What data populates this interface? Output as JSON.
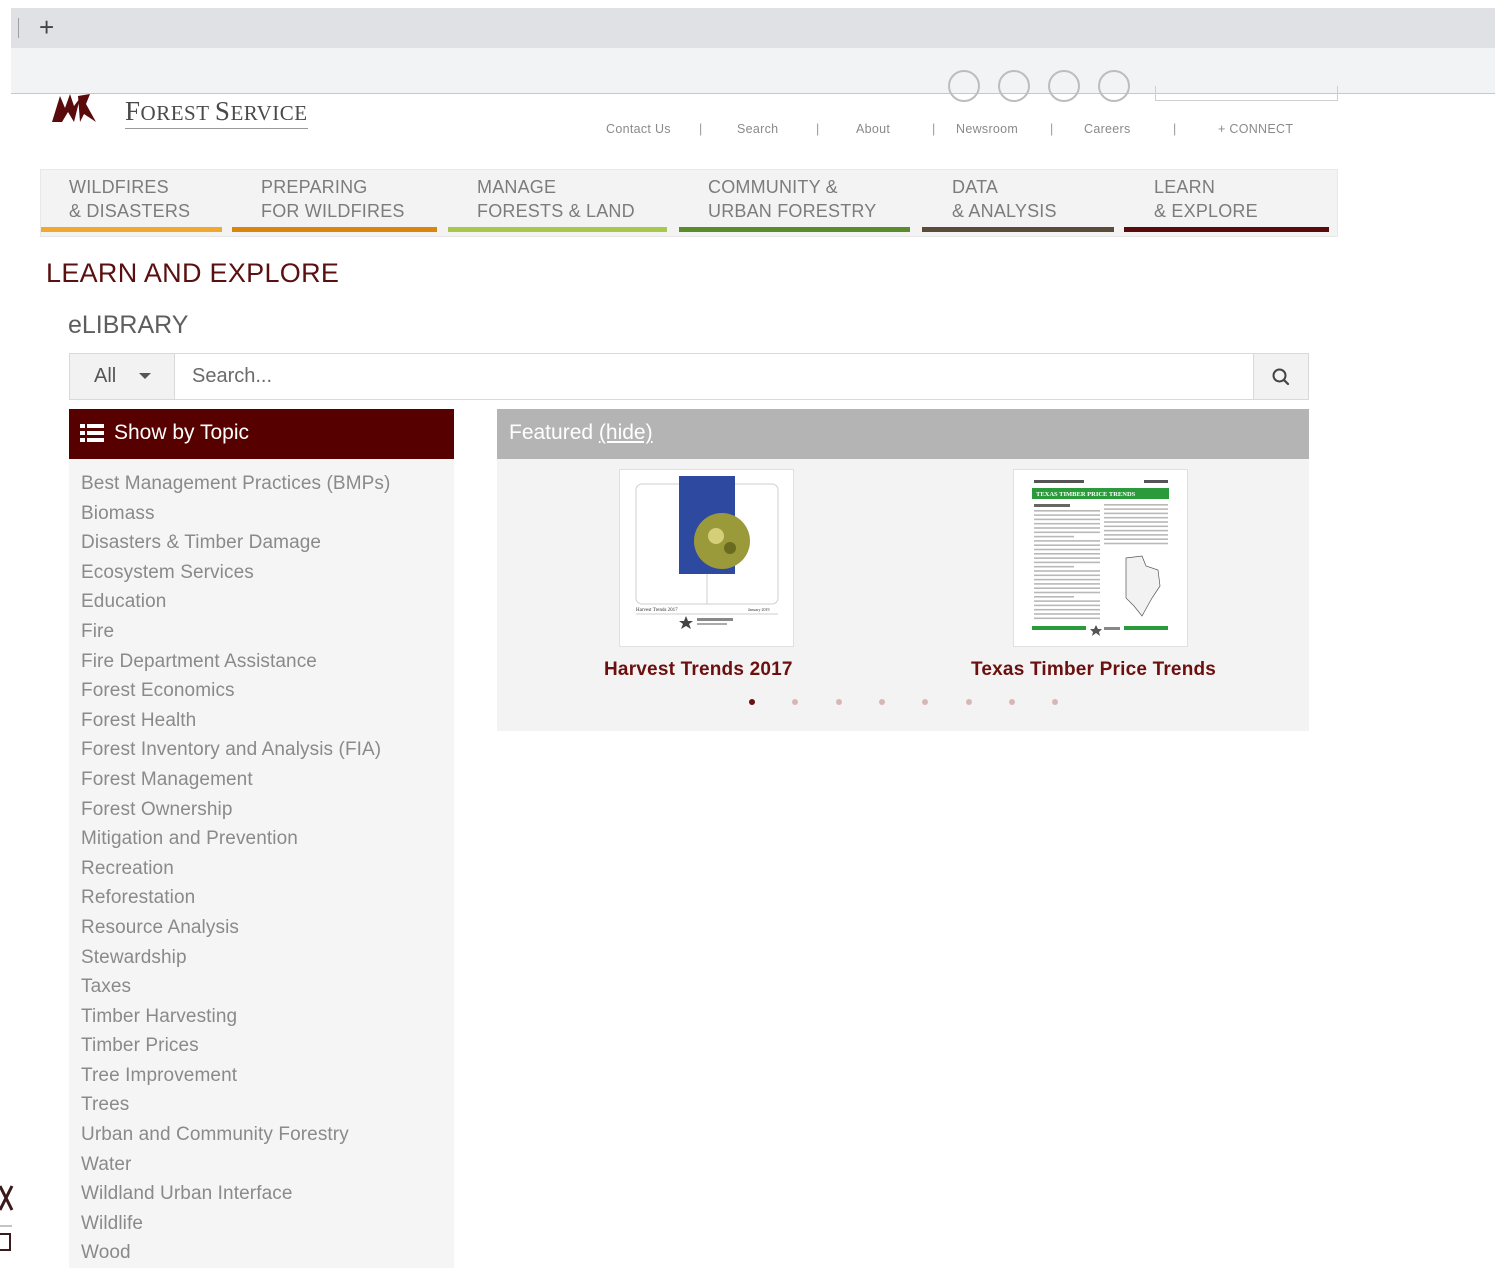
{
  "browser": {
    "new_tab_label": "+"
  },
  "header": {
    "brand_first": "F",
    "brand_rest": "OREST ",
    "brand_first2": "S",
    "brand_rest2": "ERVICE",
    "utility": [
      "Contact Us",
      "Search",
      "About",
      "Newsroom",
      "Careers",
      "+ CONNECT"
    ],
    "separator": "|"
  },
  "nav": [
    {
      "line1": "WILDFIRES",
      "line2": "& DISASTERS",
      "color": "#f0a830"
    },
    {
      "line1": "PREPARING",
      "line2": "FOR WILDFIRES",
      "color": "#d9860a"
    },
    {
      "line1": "MANAGE",
      "line2": "FORESTS & LAND",
      "color": "#a9c84a"
    },
    {
      "line1": "COMMUNITY &",
      "line2": "URBAN FORESTRY",
      "color": "#5a8c2c"
    },
    {
      "line1": "DATA",
      "line2": "& ANALYSIS",
      "color": "#5c4a3a"
    },
    {
      "line1": "LEARN",
      "line2": "& EXPLORE",
      "color": "#5a0a0a"
    }
  ],
  "page_title": "LEARN AND EXPLORE",
  "section_title": "eLIBRARY",
  "search": {
    "scope": "All",
    "placeholder": "Search..."
  },
  "topics": {
    "header": "Show by Topic",
    "items": [
      "Best Management Practices (BMPs)",
      "Biomass",
      "Disasters & Timber Damage",
      "Ecosystem Services",
      "Education",
      "Fire",
      "Fire Department Assistance",
      "Forest Economics",
      "Forest Health",
      "Forest Inventory and Analysis (FIA)",
      "Forest Management",
      "Forest Ownership",
      "Mitigation and Prevention",
      "Recreation",
      "Reforestation",
      "Resource Analysis",
      "Stewardship",
      "Taxes",
      "Timber Harvesting",
      "Timber Prices",
      "Tree Improvement",
      "Trees",
      "Urban and Community Forestry",
      "Water",
      "Wildland Urban Interface",
      "Wildlife",
      "Wood"
    ]
  },
  "featured": {
    "label": "Featured ",
    "hide_label": "(hide)",
    "cards": [
      {
        "title": "Harvest Trends 2017",
        "cover_left": "Harvest Trends 2017",
        "cover_right": "January 2019"
      },
      {
        "title": "Texas Timber Price Trends",
        "cover_band": "TEXAS TIMBER PRICE TRENDS"
      }
    ],
    "dots_total": 8,
    "dots_active_index": 0
  },
  "colors": {
    "brand_maroon": "#560000",
    "title_maroon": "#5a1010",
    "featured_grey": "#b4b4b4"
  }
}
